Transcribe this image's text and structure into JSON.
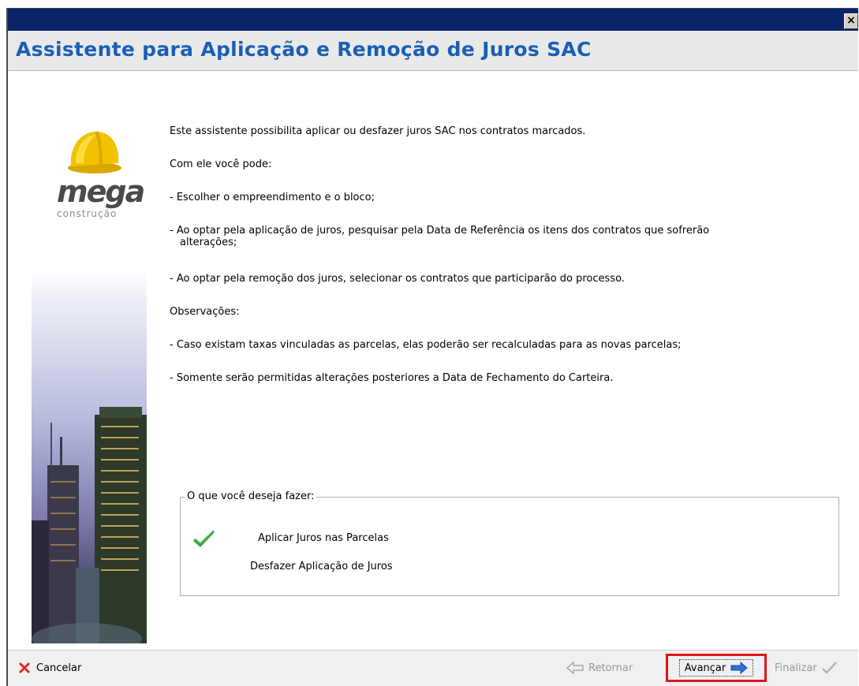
{
  "window": {
    "title": "Assistente para Aplicação e Remoção de Juros SAC",
    "close_glyph": "×"
  },
  "logo": {
    "brand": "mega",
    "sub": "construção",
    "icon": "hard-hat-icon"
  },
  "intro": [
    "Este assistente possibilita aplicar ou desfazer juros SAC nos contratos marcados.",
    "Com ele você pode:",
    "- Escolher o empreendimento e o bloco;",
    "- Ao optar pela aplicação de juros, pesquisar pela Data de Referência os itens dos contratos que sofrerão",
    "alterações;",
    "- Ao optar pela remoção dos juros, selecionar os contratos que participarão do processo.",
    "Observações:",
    "- Caso existam taxas vinculadas as parcelas, elas poderão ser recalculadas para as novas parcelas;",
    "- Somente serão permitidas alterações posteriores a Data de Fechamento do Carteira."
  ],
  "options": {
    "legend": "O que você deseja fazer:",
    "apply_label": "Aplicar Juros nas Parcelas",
    "undo_label": "Desfazer Aplicação de Juros",
    "selected": "apply"
  },
  "footer": {
    "cancel": "Cancelar",
    "back": "Retornar",
    "next": "Avançar",
    "finish": "Finalizar"
  },
  "colors": {
    "title_bar": "#0a246a",
    "title_text": "#1a5fb4",
    "highlight_border": "#e2141b",
    "check": "#3aa845"
  }
}
